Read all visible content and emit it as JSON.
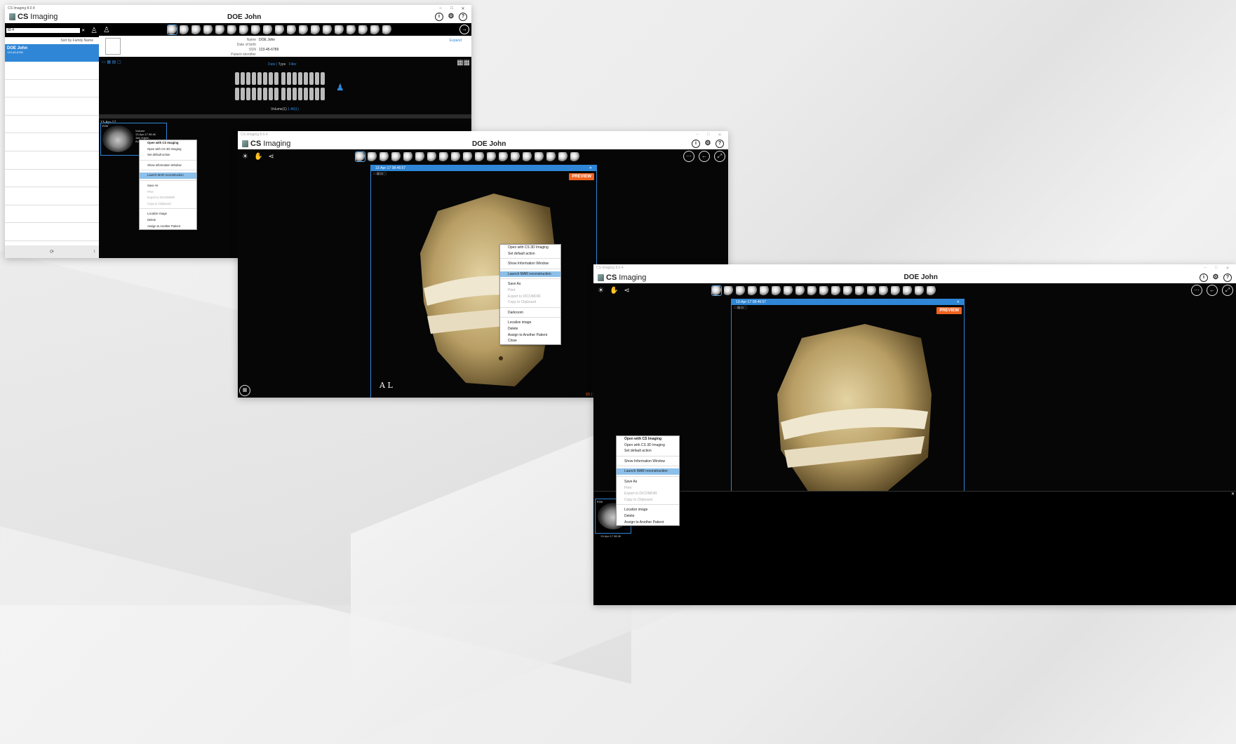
{
  "app": {
    "title": "CS Imaging 8.0.4",
    "brand_bold": "CS",
    "brand": "Imaging",
    "patient_name": "DOE John"
  },
  "window_controls": {
    "minimize": "–",
    "maximize": "□",
    "close": "✕"
  },
  "win1": {
    "search_value": "ID #",
    "sort_label": "Sort by Family Name",
    "patient_item": {
      "name": "DOE John",
      "ssn": "123-45-6789"
    },
    "info": {
      "name_label": "Name",
      "name_value": "DOE John",
      "dob_label": "Date of birth",
      "ssn_label": "SSN",
      "ssn_value": "123-45-6789",
      "pid_label": "Patient identifier",
      "expand": "Expand"
    },
    "filter": {
      "date": "Date",
      "type": "Type",
      "filter": "Filter"
    },
    "volume_label": "Volume(1)",
    "volume_count": "1 All(1)",
    "group_date": "13-Apr-17",
    "thumb": {
      "tag": "FOV",
      "line1": "Volume",
      "line2": "13-Apr-17 08:46",
      "line3": "Jaw region",
      "line4": "Acquisition Mode"
    },
    "footer_count": "1"
  },
  "menu1": [
    {
      "label": "Open with CS Imaging",
      "style": "bold"
    },
    {
      "label": "Open with CS 3D Imaging",
      "style": ""
    },
    {
      "label": "Set default action",
      "style": ""
    },
    {
      "sep": true
    },
    {
      "label": "Show Information Window",
      "style": ""
    },
    {
      "sep": true
    },
    {
      "label": "Launch MAR reconstruction",
      "style": "hl"
    },
    {
      "sep": true
    },
    {
      "label": "Save As",
      "style": ""
    },
    {
      "label": "Print",
      "style": "dis"
    },
    {
      "label": "Export to DICOMDIR",
      "style": "dis"
    },
    {
      "label": "Copy to Clipboard",
      "style": "dis"
    },
    {
      "sep": true
    },
    {
      "label": "Localize image",
      "style": ""
    },
    {
      "label": "Delete",
      "style": ""
    },
    {
      "label": "Assign to Another Patient",
      "style": ""
    }
  ],
  "win2": {
    "viewer_title": "13-Apr-17 08:46:57",
    "preview": "PREVIEW",
    "orientation": "A L",
    "corner": "3D | 2"
  },
  "menu2": [
    {
      "label": "Open with CS 3D Imaging",
      "style": ""
    },
    {
      "label": "Set default action",
      "style": ""
    },
    {
      "sep": true
    },
    {
      "label": "Show Information Window",
      "style": ""
    },
    {
      "sep": true
    },
    {
      "label": "Launch MAR reconstruction",
      "style": "hl"
    },
    {
      "sep": true
    },
    {
      "label": "Save As",
      "style": ""
    },
    {
      "label": "Print",
      "style": "dis"
    },
    {
      "label": "Export to DICOMDIR",
      "style": "dis"
    },
    {
      "label": "Copy to Clipboard",
      "style": "dis"
    },
    {
      "sep": true
    },
    {
      "label": "Darkroom",
      "style": ""
    },
    {
      "sep": true
    },
    {
      "label": "Localize image",
      "style": ""
    },
    {
      "label": "Delete",
      "style": ""
    },
    {
      "label": "Assign to Another Patient",
      "style": ""
    },
    {
      "label": "Close",
      "style": ""
    }
  ],
  "win3": {
    "viewer_title": "13-Apr-17 08:46:57",
    "preview": "PREVIEW",
    "thumb_tag": "FOV",
    "thumb_date": "13-Apr-17 08:46"
  },
  "menu3": [
    {
      "label": "Open with CS Imaging",
      "style": "bold"
    },
    {
      "label": "Open with CS 3D Imaging",
      "style": ""
    },
    {
      "label": "Set default action",
      "style": ""
    },
    {
      "sep": true
    },
    {
      "label": "Show Information Window",
      "style": ""
    },
    {
      "sep": true
    },
    {
      "label": "Launch MAR reconstruction",
      "style": "hl"
    },
    {
      "sep": true
    },
    {
      "label": "Save As",
      "style": ""
    },
    {
      "label": "Print",
      "style": "dis"
    },
    {
      "label": "Export to DICOMDIR",
      "style": "dis"
    },
    {
      "label": "Copy to Clipboard",
      "style": "dis"
    },
    {
      "sep": true
    },
    {
      "label": "Localize image",
      "style": ""
    },
    {
      "label": "Delete",
      "style": ""
    },
    {
      "label": "Assign to Another Patient",
      "style": ""
    }
  ],
  "icons": {
    "info": "info-icon",
    "settings": "gear-icon",
    "help": "help-icon"
  },
  "colors": {
    "accent": "#2f86d6",
    "highlight": "#8cc0ea",
    "preview": "#f06321",
    "bone": "#cdb98a"
  }
}
